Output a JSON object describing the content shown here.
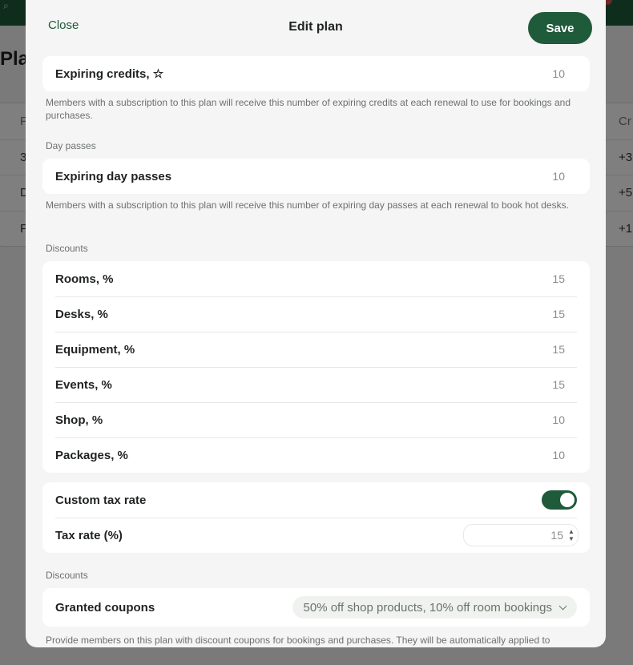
{
  "background": {
    "page_title": "Pla",
    "table_header_left": "P",
    "table_header_right": "Cr",
    "rows_left": [
      "3",
      "D",
      "P"
    ],
    "rows_right": [
      "+3",
      "+5",
      "+1("
    ]
  },
  "modal": {
    "close_label": "Close",
    "title": "Edit plan",
    "save_label": "Save",
    "expiring_credits": {
      "label": "Expiring credits, ☆",
      "value": "10",
      "help": "Members with a subscription to this plan will receive this number of expiring credits at each renewal to use for bookings and purchases."
    },
    "day_passes_section": "Day passes",
    "expiring_day_passes": {
      "label": "Expiring day passes",
      "value": "10",
      "help": "Members with a subscription to this plan will receive this number of expiring day passes at each renewal to book hot desks."
    },
    "discounts_section": "Discounts",
    "discounts": [
      {
        "label": "Rooms, %",
        "value": "15"
      },
      {
        "label": "Desks, %",
        "value": "15"
      },
      {
        "label": "Equipment, %",
        "value": "15"
      },
      {
        "label": "Events, %",
        "value": "15"
      },
      {
        "label": "Shop, %",
        "value": "10"
      },
      {
        "label": "Packages, %",
        "value": "10"
      }
    ],
    "custom_tax_rate": {
      "label": "Custom tax rate",
      "enabled": true
    },
    "tax_rate": {
      "label": "Tax rate (%)",
      "value": "15"
    },
    "coupons_section": "Discounts",
    "granted_coupons": {
      "label": "Granted coupons",
      "value": "50% off shop products, 10% off room bookings",
      "help": "Provide members on this plan with discount coupons for bookings and purchases. They will be automatically applied to"
    }
  },
  "colors": {
    "accent": "#1f5a3a"
  },
  "icons": {
    "stepper": "stepper-arrows-icon",
    "dropdown": "chevron-down-icon",
    "star": "star-icon"
  }
}
